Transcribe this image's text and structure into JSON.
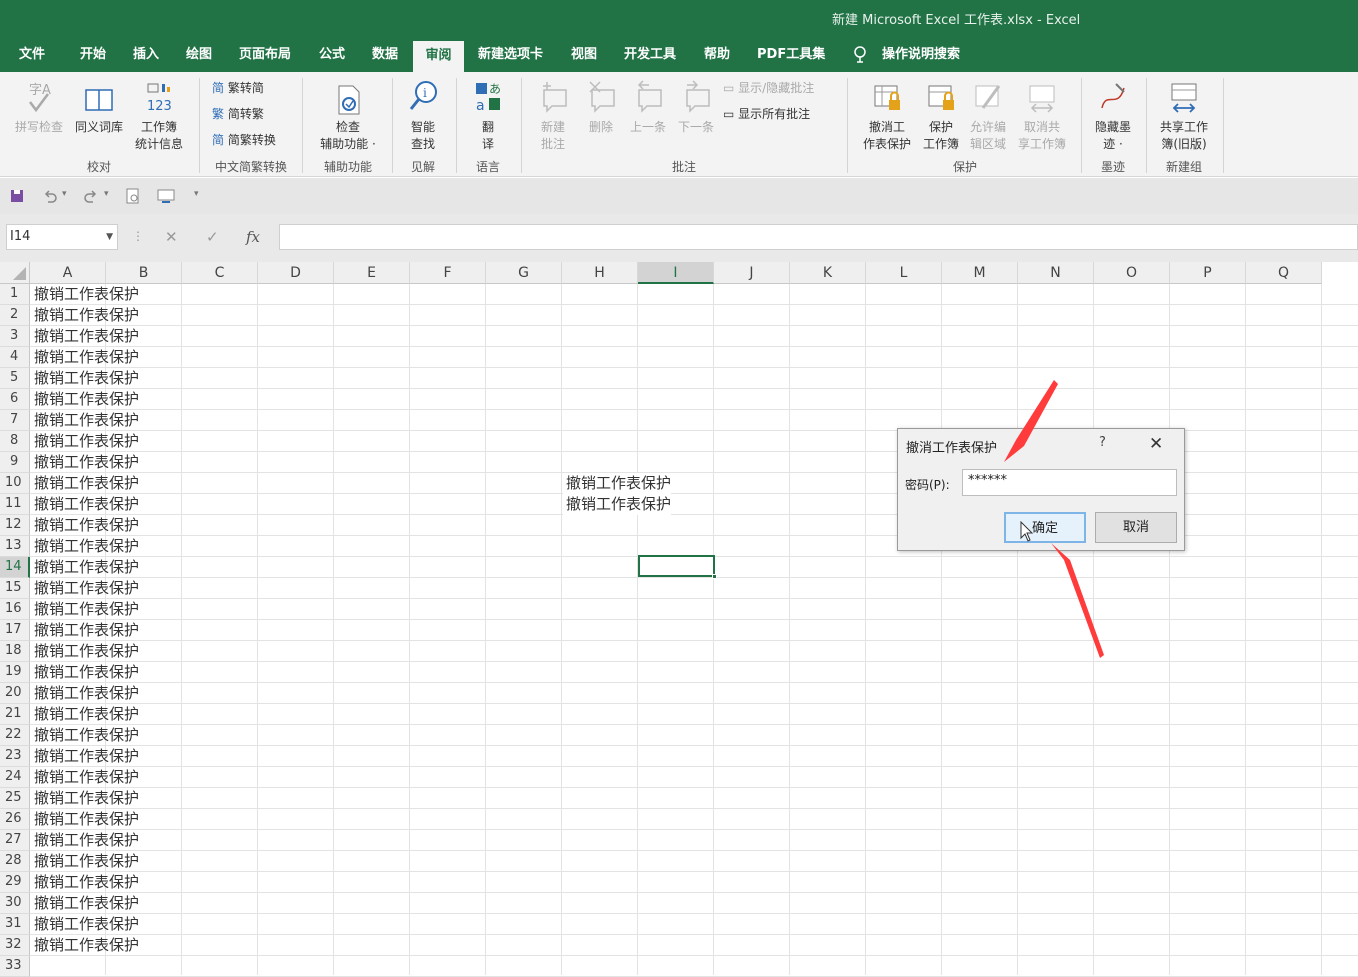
{
  "window": {
    "title": "新建 Microsoft Excel 工作表.xlsx  -  Excel",
    "accent_color": "#217346"
  },
  "tabs": [
    {
      "label": "文件",
      "active": false
    },
    {
      "label": "开始",
      "active": false
    },
    {
      "label": "插入",
      "active": false
    },
    {
      "label": "绘图",
      "active": false
    },
    {
      "label": "页面布局",
      "active": false
    },
    {
      "label": "公式",
      "active": false
    },
    {
      "label": "数据",
      "active": false
    },
    {
      "label": "审阅",
      "active": true
    },
    {
      "label": "新建选项卡",
      "active": false
    },
    {
      "label": "视图",
      "active": false
    },
    {
      "label": "开发工具",
      "active": false
    },
    {
      "label": "帮助",
      "active": false
    },
    {
      "label": "PDF工具集",
      "active": false
    },
    {
      "label": "操作说明搜索",
      "active": false,
      "icon": "lightbulb-icon"
    }
  ],
  "ribbon": {
    "groups": {
      "proofing": "校对",
      "chinese_conversion": "中文简繁转换",
      "accessibility": "辅助功能",
      "insights": "见解",
      "language": "语言",
      "comments": "批注",
      "protect": "保护",
      "ink": "墨迹",
      "new_group": "新建组"
    },
    "buttons": {
      "spell_check": "拼写检查",
      "thesaurus": "同义词库",
      "workbook_stats_1": "工作簿",
      "workbook_stats_2": "统计信息",
      "trad_to_simp": "繁转简",
      "simp_to_trad": "简转繁",
      "conversion": "简繁转换",
      "check_1": "检查",
      "check_2": "辅助功能 ·",
      "smart_lookup_1": "智能",
      "smart_lookup_2": "查找",
      "translate_1": "翻",
      "translate_2": "译",
      "new_comment_1": "新建",
      "new_comment_2": "批注",
      "delete": "删除",
      "previous": "上一条",
      "next": "下一条",
      "show_hide_comment": "显示/隐藏批注",
      "show_all_comments": "显示所有批注",
      "unprotect_sheet_1": "撤消工",
      "unprotect_sheet_2": "作表保护",
      "protect_workbook_1": "保护",
      "protect_workbook_2": "工作簿",
      "allow_edit_1": "允许编",
      "allow_edit_2": "辑区域",
      "unshare_1": "取消共",
      "unshare_2": "享工作簿",
      "hide_ink_1": "隐藏墨",
      "hide_ink_2": "迹 ·",
      "share_workbook_1": "共享工作",
      "share_workbook_2": "簿(旧版)"
    }
  },
  "qat": {
    "icons": [
      "save-icon",
      "undo-icon",
      "redo-icon",
      "print-preview-icon",
      "screen-icon",
      "customize-icon"
    ]
  },
  "formula_bar": {
    "name_box": "I14",
    "cancel_symbol": "✕",
    "enter_symbol": "✓",
    "fx_symbol": "fx",
    "formula": ""
  },
  "sheet": {
    "columns": [
      "A",
      "B",
      "C",
      "D",
      "E",
      "F",
      "G",
      "H",
      "I",
      "J",
      "K",
      "L",
      "M",
      "N",
      "O",
      "P",
      "Q"
    ],
    "selected_column": "I",
    "rows": [
      "1",
      "2",
      "3",
      "4",
      "5",
      "6",
      "7",
      "8",
      "9",
      "10",
      "11",
      "12",
      "13",
      "14",
      "15",
      "16",
      "17",
      "18",
      "19",
      "20",
      "21",
      "22",
      "23",
      "24",
      "25",
      "26",
      "27",
      "28",
      "29",
      "30",
      "31",
      "32",
      "33"
    ],
    "selected_row": "14",
    "selected_cell": "I14",
    "col_a_values": [
      "撤销工作表保护",
      "撤销工作表保护",
      "撤销工作表保护",
      "撤销工作表保护",
      "撤销工作表保护",
      "撤销工作表保护",
      "撤销工作表保护",
      "撤销工作表保护",
      "撤销工作表保护",
      "撤销工作表保护",
      "撤销工作表保护",
      "撤销工作表保护",
      "撤销工作表保护",
      "撤销工作表保护",
      "撤销工作表保护",
      "撤销工作表保护",
      "撤销工作表保护",
      "撤销工作表保护",
      "撤销工作表保护",
      "撤销工作表保护",
      "撤销工作表保护",
      "撤销工作表保护",
      "撤销工作表保护",
      "撤销工作表保护",
      "撤销工作表保护",
      "撤销工作表保护",
      "撤销工作表保护",
      "撤销工作表保护",
      "撤销工作表保护",
      "撤销工作表保护",
      "撤销工作表保护",
      "撤销工作表保护"
    ],
    "h10": "撤销工作表保护",
    "h11": "撤销工作表保护"
  },
  "dialog": {
    "title": "撤消工作表保护",
    "help": "?",
    "close": "✕",
    "password_label": "密码(P):",
    "password_value": "******",
    "ok_label": "确定",
    "cancel_label": "取消"
  },
  "annotation_color": "#ff3b3b"
}
